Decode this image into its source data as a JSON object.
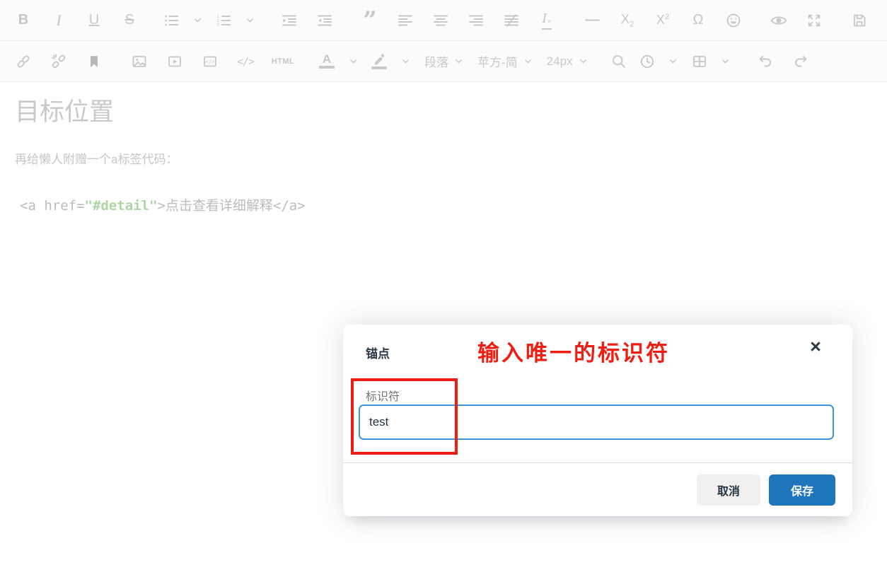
{
  "toolbar": {
    "glyphs": {
      "bold": "B",
      "italic": "I",
      "underline": "U",
      "strikethrough": "S",
      "blockquote": "”",
      "clear_format_base": "I",
      "clear_format_mark": "×",
      "horizontal_rule": "—",
      "subscript_base": "X",
      "subscript_mark": "2",
      "superscript_base": "X",
      "superscript_mark": "2",
      "special_character": "Ω",
      "source_code": "</>",
      "html_view": "HTML",
      "text_color": "A"
    },
    "dropdowns": {
      "paragraph_format": "段落",
      "font_family": "苹方-简",
      "font_size": "24px"
    }
  },
  "content": {
    "heading": "目标位置",
    "paragraph": "再给懒人附赠一个a标签代码：",
    "code_parts": [
      {
        "text": "<a href="
      },
      {
        "text": "\"#detail\""
      },
      {
        "text": ">点击查看详细解释</a>"
      }
    ]
  },
  "dialog": {
    "title": "锚点",
    "annotation": "输入唯一的标识符",
    "close_glyph": "×",
    "field_label": "标识符",
    "field_value": "test",
    "cancel_label": "取消",
    "save_label": "保存",
    "colors": {
      "accent_blue": "#2076bc",
      "input_border_blue": "#4094d8",
      "annotation_red": "#f01e12"
    }
  }
}
